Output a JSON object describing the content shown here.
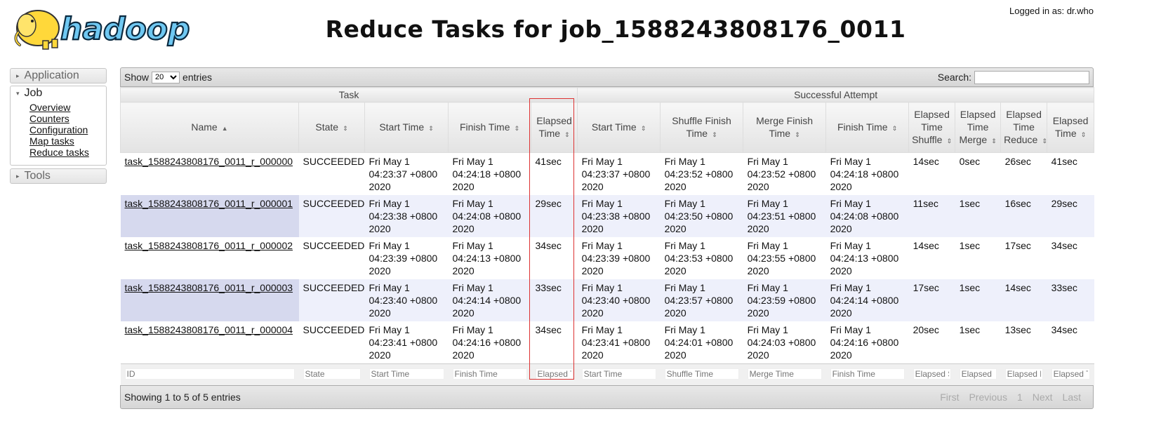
{
  "header": {
    "logo_text": "hadoop",
    "title": "Reduce Tasks for job_1588243808176_0011",
    "login": "Logged in as: dr.who"
  },
  "nav": {
    "application": "Application",
    "job": "Job",
    "job_links": [
      "Overview",
      "Counters",
      "Configuration",
      "Map tasks",
      "Reduce tasks"
    ],
    "tools": "Tools"
  },
  "toolbar": {
    "show": "Show",
    "entries_value": "20",
    "entries": "entries",
    "search": "Search:"
  },
  "groups": {
    "task": "Task",
    "attempt": "Successful Attempt"
  },
  "columns": [
    "Name",
    "State",
    "Start Time",
    "Finish Time",
    "Elapsed Time",
    "Start Time",
    "Shuffle Finish Time",
    "Merge Finish Time",
    "Finish Time",
    "Elapsed Time Shuffle",
    "Elapsed Time Merge",
    "Elapsed Time Reduce",
    "Elapsed Time"
  ],
  "rows": [
    [
      "task_1588243808176_0011_r_000000",
      "SUCCEEDED",
      "Fri May 1 04:23:37 +0800 2020",
      "Fri May 1 04:24:18 +0800 2020",
      "41sec",
      "Fri May 1 04:23:37 +0800 2020",
      "Fri May 1 04:23:52 +0800 2020",
      "Fri May 1 04:23:52 +0800 2020",
      "Fri May 1 04:24:18 +0800 2020",
      "14sec",
      "0sec",
      "26sec",
      "41sec"
    ],
    [
      "task_1588243808176_0011_r_000001",
      "SUCCEEDED",
      "Fri May 1 04:23:38 +0800 2020",
      "Fri May 1 04:24:08 +0800 2020",
      "29sec",
      "Fri May 1 04:23:38 +0800 2020",
      "Fri May 1 04:23:50 +0800 2020",
      "Fri May 1 04:23:51 +0800 2020",
      "Fri May 1 04:24:08 +0800 2020",
      "11sec",
      "1sec",
      "16sec",
      "29sec"
    ],
    [
      "task_1588243808176_0011_r_000002",
      "SUCCEEDED",
      "Fri May 1 04:23:39 +0800 2020",
      "Fri May 1 04:24:13 +0800 2020",
      "34sec",
      "Fri May 1 04:23:39 +0800 2020",
      "Fri May 1 04:23:53 +0800 2020",
      "Fri May 1 04:23:55 +0800 2020",
      "Fri May 1 04:24:13 +0800 2020",
      "14sec",
      "1sec",
      "17sec",
      "34sec"
    ],
    [
      "task_1588243808176_0011_r_000003",
      "SUCCEEDED",
      "Fri May 1 04:23:40 +0800 2020",
      "Fri May 1 04:24:14 +0800 2020",
      "33sec",
      "Fri May 1 04:23:40 +0800 2020",
      "Fri May 1 04:23:57 +0800 2020",
      "Fri May 1 04:23:59 +0800 2020",
      "Fri May 1 04:24:14 +0800 2020",
      "17sec",
      "1sec",
      "14sec",
      "33sec"
    ],
    [
      "task_1588243808176_0011_r_000004",
      "SUCCEEDED",
      "Fri May 1 04:23:41 +0800 2020",
      "Fri May 1 04:24:16 +0800 2020",
      "34sec",
      "Fri May 1 04:23:41 +0800 2020",
      "Fri May 1 04:24:01 +0800 2020",
      "Fri May 1 04:24:03 +0800 2020",
      "Fri May 1 04:24:16 +0800 2020",
      "20sec",
      "1sec",
      "13sec",
      "34sec"
    ]
  ],
  "filters": [
    "ID",
    "State",
    "Start Time",
    "Finish Time",
    "Elapsed Time",
    "Start Time",
    "Shuffle Time",
    "Merge Time",
    "Finish Time",
    "Elapsed Shuffle Time",
    "Elapsed Merge Time",
    "Elapsed Reduce Time",
    "Elapsed Time"
  ],
  "footer": {
    "showing": "Showing 1 to 5 of 5 entries",
    "first": "First",
    "previous": "Previous",
    "page": "1",
    "next": "Next",
    "last": "Last"
  },
  "colors": {
    "highlight": "#d33333",
    "even_row": "#eef0fb",
    "logo_yellow": "#ffd83a"
  }
}
